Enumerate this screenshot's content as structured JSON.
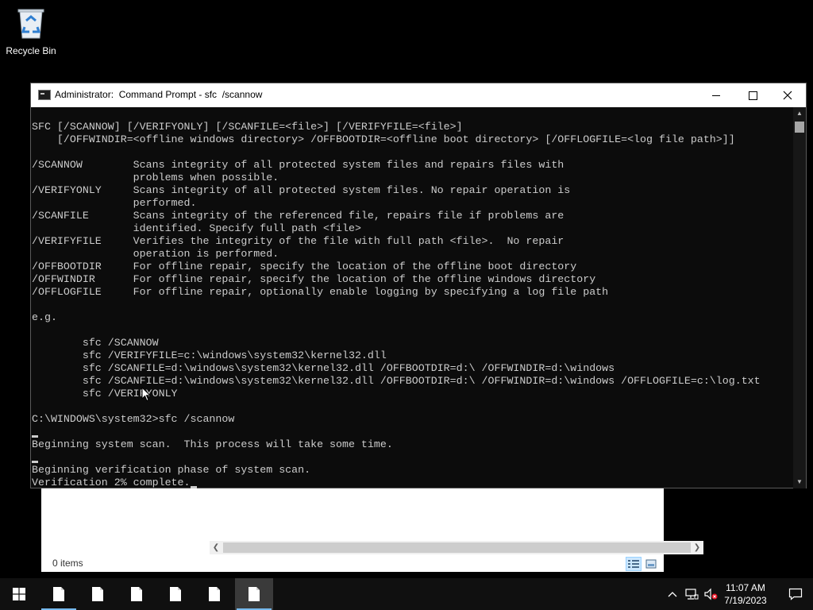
{
  "desktop": {
    "recycle_bin_label": "Recycle Bin"
  },
  "explorer": {
    "status_items": "0 items"
  },
  "cmd": {
    "title": "Administrator:  Command Prompt - sfc  /scannow",
    "console_text": "SFC [/SCANNOW] [/VERIFYONLY] [/SCANFILE=<file>] [/VERIFYFILE=<file>]\n    [/OFFWINDIR=<offline windows directory> /OFFBOOTDIR=<offline boot directory> [/OFFLOGFILE=<log file path>]]\n\n/SCANNOW        Scans integrity of all protected system files and repairs files with\n                problems when possible.\n/VERIFYONLY     Scans integrity of all protected system files. No repair operation is\n                performed.\n/SCANFILE       Scans integrity of the referenced file, repairs file if problems are\n                identified. Specify full path <file>\n/VERIFYFILE     Verifies the integrity of the file with full path <file>.  No repair\n                operation is performed.\n/OFFBOOTDIR     For offline repair, specify the location of the offline boot directory\n/OFFWINDIR      For offline repair, specify the location of the offline windows directory\n/OFFLOGFILE     For offline repair, optionally enable logging by specifying a log file path\n\ne.g.\n\n        sfc /SCANNOW\n        sfc /VERIFYFILE=c:\\windows\\system32\\kernel32.dll\n        sfc /SCANFILE=d:\\windows\\system32\\kernel32.dll /OFFBOOTDIR=d:\\ /OFFWINDIR=d:\\windows\n        sfc /SCANFILE=d:\\windows\\system32\\kernel32.dll /OFFBOOTDIR=d:\\ /OFFWINDIR=d:\\windows /OFFLOGFILE=c:\\log.txt\n        sfc /VERIFYONLY\n\nC:\\WINDOWS\\system32>sfc /scannow\n\nBeginning system scan.  This process will take some time.\n\nBeginning verification phase of system scan.\nVerification 2% complete."
  },
  "taskbar": {
    "time": "11:07 AM",
    "date": "7/19/2023"
  },
  "colors": {
    "console_bg": "#0c0c0c",
    "console_text": "#cccccc",
    "taskbar_bg": "#101010",
    "accent": "#76b9ed"
  }
}
